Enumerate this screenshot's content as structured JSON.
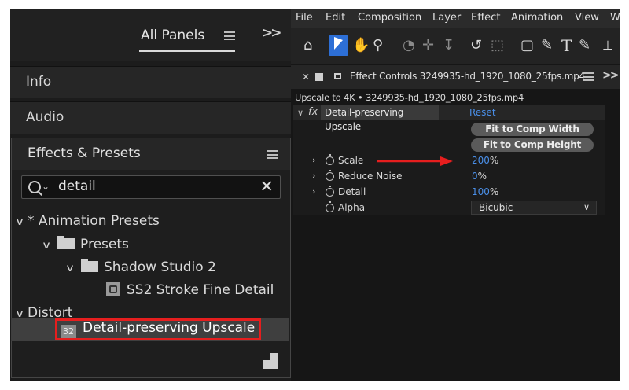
{
  "panels_header": {
    "title": "All Panels"
  },
  "panels": {
    "info": "Info",
    "audio": "Audio"
  },
  "effects_presets": {
    "title": "Effects & Presets",
    "search_value": "detail",
    "tree": {
      "animation_presets": "* Animation Presets",
      "presets": "Presets",
      "shadow_studio": "Shadow Studio 2",
      "ss2_stroke": "SS2 Stroke Fine Detail",
      "distort": "Distort",
      "detail_upscale": "Detail-preserving Upscale"
    }
  },
  "menu": [
    "File",
    "Edit",
    "Composition",
    "Layer",
    "Effect",
    "Animation",
    "View",
    "W"
  ],
  "effect_controls": {
    "tab_title": "Effect Controls 3249935-hd_1920_1080_25fps.mp4",
    "subtitle": "Upscale to 4K • 3249935-hd_1920_1080_25fps.mp4",
    "effect": {
      "fx_symbol": "fx",
      "name": "Detail-preserving Upscale",
      "reset": "Reset"
    },
    "buttons": {
      "fit_width": "Fit to Comp Width",
      "fit_height": "Fit to Comp Height"
    },
    "props": {
      "scale": {
        "label": "Scale",
        "value": "200",
        "unit": "%"
      },
      "reduce_noise": {
        "label": "Reduce Noise",
        "value": "0",
        "unit": "%"
      },
      "detail": {
        "label": "Detail",
        "value": "100",
        "unit": "%"
      },
      "alpha": {
        "label": "Alpha",
        "value": "Bicubic"
      }
    }
  },
  "colors": {
    "highlight_box": "#e61e1e",
    "link_blue": "#4a8fe8",
    "select_tool": "#2d6fd6"
  }
}
